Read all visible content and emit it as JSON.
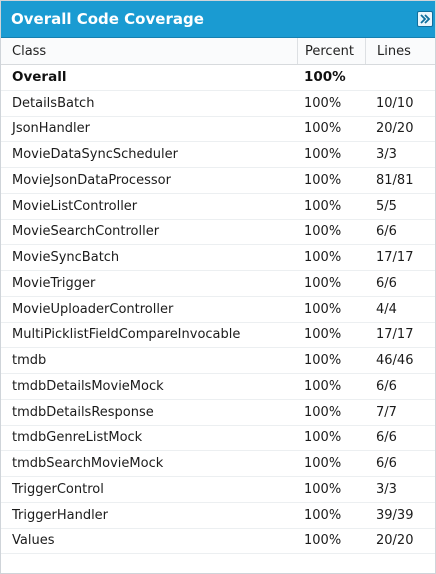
{
  "panel": {
    "title": "Overall Code Coverage",
    "collapse_icon": "double-chevron-right-icon"
  },
  "columns": {
    "class": "Class",
    "percent": "Percent",
    "lines": "Lines"
  },
  "overall": {
    "class": "Overall",
    "percent": "100%",
    "lines": ""
  },
  "rows": [
    {
      "class": "DetailsBatch",
      "percent": "100%",
      "lines": "10/10"
    },
    {
      "class": "JsonHandler",
      "percent": "100%",
      "lines": "20/20"
    },
    {
      "class": "MovieDataSyncScheduler",
      "percent": "100%",
      "lines": "3/3"
    },
    {
      "class": "MovieJsonDataProcessor",
      "percent": "100%",
      "lines": "81/81"
    },
    {
      "class": "MovieListController",
      "percent": "100%",
      "lines": "5/5"
    },
    {
      "class": "MovieSearchController",
      "percent": "100%",
      "lines": "6/6"
    },
    {
      "class": "MovieSyncBatch",
      "percent": "100%",
      "lines": "17/17"
    },
    {
      "class": "MovieTrigger",
      "percent": "100%",
      "lines": "6/6"
    },
    {
      "class": "MovieUploaderController",
      "percent": "100%",
      "lines": "4/4"
    },
    {
      "class": "MultiPicklistFieldCompareInvocable",
      "percent": "100%",
      "lines": "17/17"
    },
    {
      "class": "tmdb",
      "percent": "100%",
      "lines": "46/46"
    },
    {
      "class": "tmdbDetailsMovieMock",
      "percent": "100%",
      "lines": "6/6"
    },
    {
      "class": "tmdbDetailsResponse",
      "percent": "100%",
      "lines": "7/7"
    },
    {
      "class": "tmdbGenreListMock",
      "percent": "100%",
      "lines": "6/6"
    },
    {
      "class": "tmdbSearchMovieMock",
      "percent": "100%",
      "lines": "6/6"
    },
    {
      "class": "TriggerControl",
      "percent": "100%",
      "lines": "3/3"
    },
    {
      "class": "TriggerHandler",
      "percent": "100%",
      "lines": "39/39"
    },
    {
      "class": "Values",
      "percent": "100%",
      "lines": "20/20"
    }
  ],
  "colors": {
    "header_bg": "#1a9bd2",
    "header_text": "#ffffff"
  }
}
